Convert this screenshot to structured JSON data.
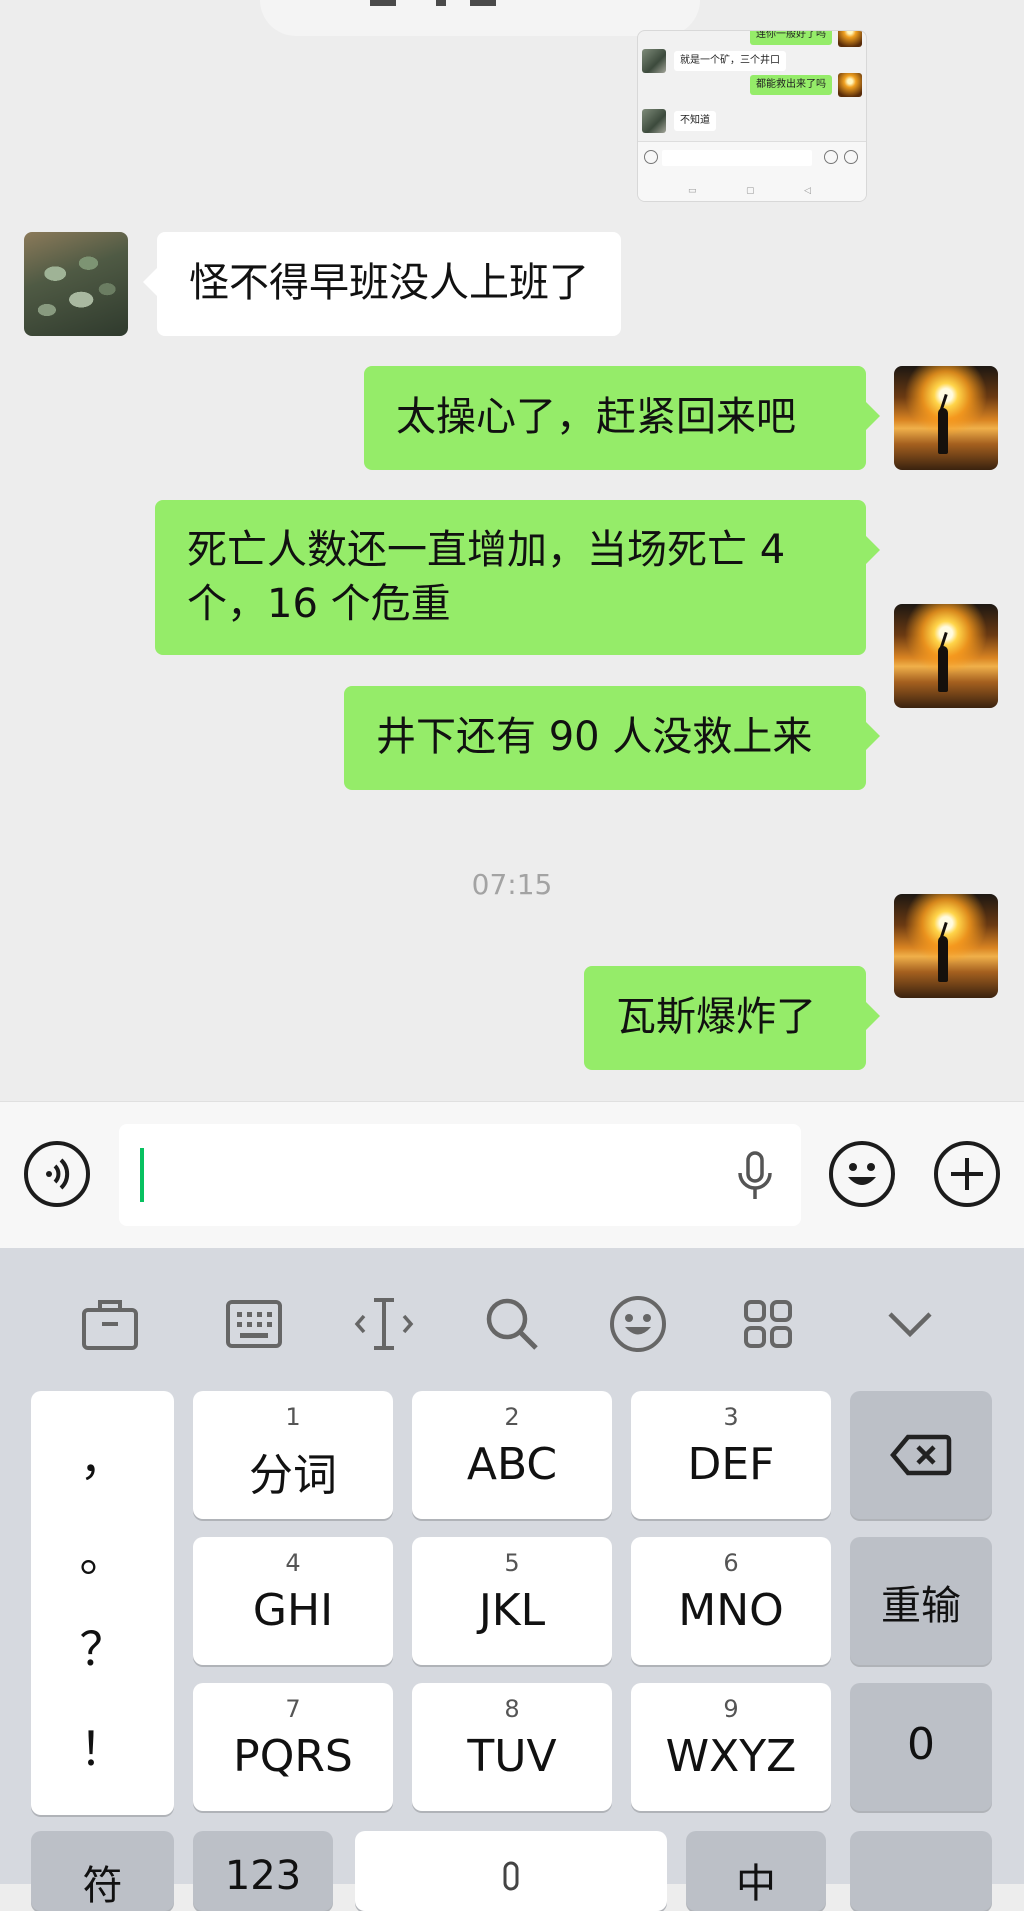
{
  "thumbnail": {
    "messages": [
      {
        "side": "right",
        "text": "连你一般好了吗"
      },
      {
        "side": "left",
        "text": "就是一个矿，三个井口"
      },
      {
        "side": "right",
        "text": "都能救出来了吗"
      },
      {
        "side": "left",
        "text": "不知道"
      }
    ]
  },
  "chat": {
    "messages": [
      {
        "side": "left",
        "text": "怪不得早班没人上班了"
      },
      {
        "side": "right",
        "text": "太操心了，赶紧回来吧"
      },
      {
        "side": "right",
        "text": "死亡人数还一直增加，当场死亡 4 个，16 个危重"
      },
      {
        "side": "right",
        "text": "井下还有 90 人没救上来"
      },
      {
        "side": "right",
        "text": "瓦斯爆炸了"
      }
    ],
    "timestamp": "07:15"
  },
  "input_bar": {
    "voice_icon": "voice-icon",
    "mic_icon": "mic-icon",
    "emoji_icon": "emoji-icon",
    "plus_icon": "plus-icon",
    "value": ""
  },
  "keyboard": {
    "toolbar": [
      "toolbox-icon",
      "keyboard-icon",
      "cursor-icon",
      "search-icon",
      "emoji-icon",
      "grid-icon",
      "chevron-down-icon"
    ],
    "punctuation": [
      "，",
      "。",
      "？",
      "！"
    ],
    "keys": [
      {
        "num": "1",
        "label": "分词"
      },
      {
        "num": "2",
        "label": "ABC"
      },
      {
        "num": "3",
        "label": "DEF"
      },
      {
        "num": "4",
        "label": "GHI"
      },
      {
        "num": "5",
        "label": "JKL"
      },
      {
        "num": "6",
        "label": "MNO"
      },
      {
        "num": "7",
        "label": "PQRS"
      },
      {
        "num": "8",
        "label": "TUV"
      },
      {
        "num": "9",
        "label": "WXYZ"
      }
    ],
    "reinput_label": "重输",
    "zero_label": "0",
    "bottom_row": [
      "符",
      "123",
      "",
      "中",
      ""
    ]
  },
  "colors": {
    "green": "#95ec69",
    "background": "#ededed",
    "caret": "#07c160",
    "keyboard": "#d6d9df"
  }
}
